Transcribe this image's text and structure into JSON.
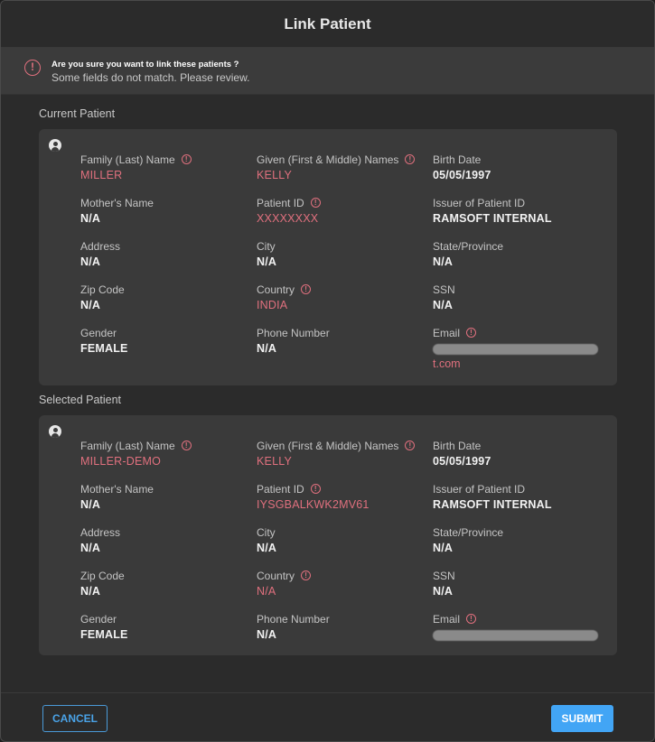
{
  "dialog": {
    "title": "Link Patient"
  },
  "warning": {
    "title": "Are you sure you want to link these patients ?",
    "message": "Some fields do not match. Please review."
  },
  "current": {
    "section_title": "Current Patient",
    "fields": {
      "family_name": {
        "label": "Family (Last) Name",
        "value": "MILLER"
      },
      "given_name": {
        "label": "Given (First & Middle) Names",
        "value": "KELLY"
      },
      "birth_date": {
        "label": "Birth Date",
        "value": "05/05/1997"
      },
      "mothers_name": {
        "label": "Mother's Name",
        "value": "N/A"
      },
      "patient_id": {
        "label": "Patient ID",
        "value": "XXXXXXXX"
      },
      "issuer": {
        "label": "Issuer of Patient ID",
        "value": "RAMSOFT INTERNAL"
      },
      "address": {
        "label": "Address",
        "value": "N/A"
      },
      "city": {
        "label": "City",
        "value": "N/A"
      },
      "state": {
        "label": "State/Province",
        "value": "N/A"
      },
      "zip": {
        "label": "Zip Code",
        "value": "N/A"
      },
      "country": {
        "label": "Country",
        "value": "INDIA"
      },
      "ssn": {
        "label": "SSN",
        "value": "N/A"
      },
      "gender": {
        "label": "Gender",
        "value": "FEMALE"
      },
      "phone": {
        "label": "Phone Number",
        "value": "N/A"
      },
      "email": {
        "label": "Email",
        "value": "t.com"
      }
    }
  },
  "selected": {
    "section_title": "Selected Patient",
    "fields": {
      "family_name": {
        "label": "Family (Last) Name",
        "value": "MILLER-DEMO"
      },
      "given_name": {
        "label": "Given (First & Middle) Names",
        "value": "KELLY"
      },
      "birth_date": {
        "label": "Birth Date",
        "value": "05/05/1997"
      },
      "mothers_name": {
        "label": "Mother's Name",
        "value": "N/A"
      },
      "patient_id": {
        "label": "Patient ID",
        "value": "IYSGBALKWK2MV61"
      },
      "issuer": {
        "label": "Issuer of Patient ID",
        "value": "RAMSOFT INTERNAL"
      },
      "address": {
        "label": "Address",
        "value": "N/A"
      },
      "city": {
        "label": "City",
        "value": "N/A"
      },
      "state": {
        "label": "State/Province",
        "value": "N/A"
      },
      "zip": {
        "label": "Zip Code",
        "value": "N/A"
      },
      "country": {
        "label": "Country",
        "value": "N/A"
      },
      "ssn": {
        "label": "SSN",
        "value": "N/A"
      },
      "gender": {
        "label": "Gender",
        "value": "FEMALE"
      },
      "phone": {
        "label": "Phone Number",
        "value": "N/A"
      },
      "email": {
        "label": "Email",
        "value": ""
      }
    }
  },
  "footer": {
    "cancel_label": "CANCEL",
    "submit_label": "SUBMIT"
  },
  "colors": {
    "mismatch": "#e0707e",
    "accent": "#42a5f5",
    "background": "#2b2b2b",
    "card": "#3a3a3a"
  },
  "icons": {
    "warning": "alert-circle-icon",
    "mismatch": "info-circle-icon",
    "patient": "account-circle-icon"
  }
}
